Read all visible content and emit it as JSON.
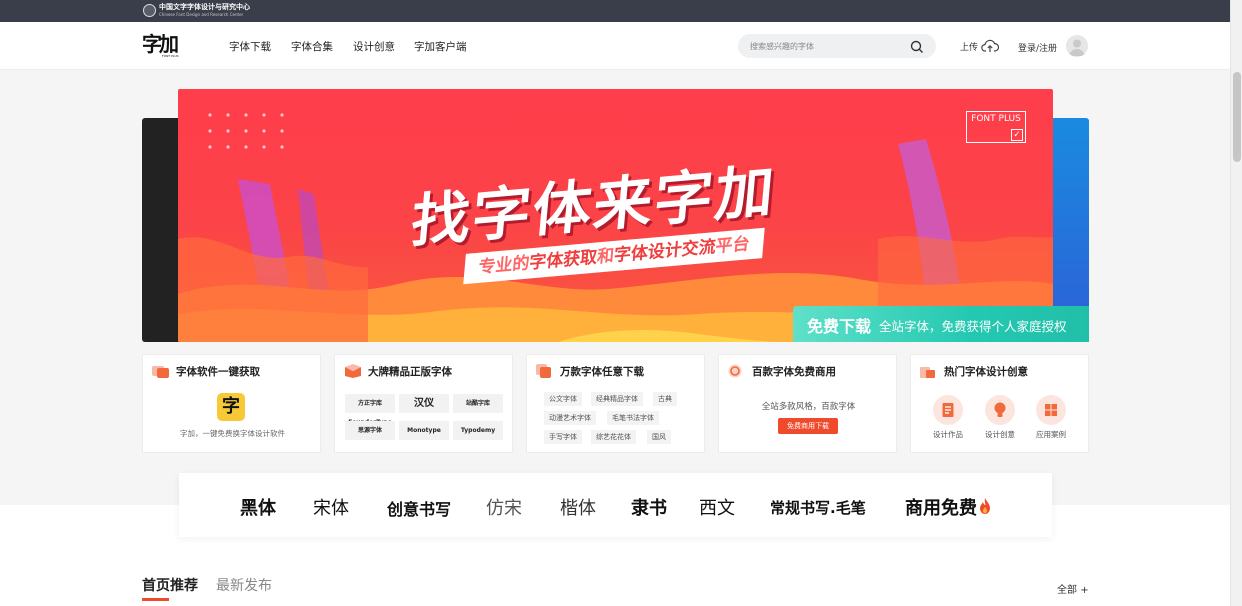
{
  "topbar": {
    "org_name": "中国文字字体设计与研究中心",
    "org_name_en": "Chinese Font Design and Research Center"
  },
  "header": {
    "logo_text": "字加",
    "logo_sub": "FONT PLUS",
    "nav": [
      "字体下载",
      "字体合集",
      "设计创意",
      "字加客户端"
    ],
    "search_placeholder": "搜索感兴趣的字体",
    "upload_label": "上传",
    "login_label": "登录/注册"
  },
  "banner": {
    "title": "找字体来字加",
    "subtitle_parts": [
      "专业的",
      "字体获取",
      "和",
      "字体设计交流",
      "平台"
    ],
    "brand": "FONT PLUS",
    "free_label": "免费下载",
    "free_desc": "全站字体，免费获得个人家庭授权"
  },
  "cards": [
    {
      "title": "字体软件一键获取",
      "icon": "font-software-icon",
      "app_glyph": "字",
      "desc": "字加，一键免费换字体设计软件"
    },
    {
      "title": "大牌精品正版字体",
      "icon": "brand-font-icon",
      "brands": [
        "方正字库 FounderType",
        "汉仪",
        "站酷字库",
        "思源字体",
        "Monotype",
        "Typodemy"
      ]
    },
    {
      "title": "万款字体任意下载",
      "icon": "download-font-icon",
      "tags": [
        "公文字体",
        "经典精品字体",
        "古典",
        "动漫艺术字体",
        "毛笔书法字体",
        "手写字体",
        "综艺花花体",
        "国风"
      ]
    },
    {
      "title": "百款字体免费商用",
      "icon": "free-commercial-icon",
      "desc": "全站多款风格，百款字体",
      "button": "免费商用下载"
    },
    {
      "title": "热门字体设计创意",
      "icon": "hot-design-icon",
      "items": [
        "设计作品",
        "设计创意",
        "应用案例"
      ]
    }
  ],
  "categories": [
    "黑体",
    "宋体",
    "创意书写",
    "仿宋",
    "楷体",
    "隶书",
    "西文",
    "常规书写.毛笔",
    "商用免费"
  ],
  "tabs": {
    "items": [
      "首页推荐",
      "最新发布"
    ],
    "active": 0,
    "all_label": "全部"
  },
  "colors": {
    "accent": "#f04a2c",
    "banner_red": "#ff3d4b",
    "teal": "#24c8b1",
    "topbar": "#3a3d4a"
  }
}
